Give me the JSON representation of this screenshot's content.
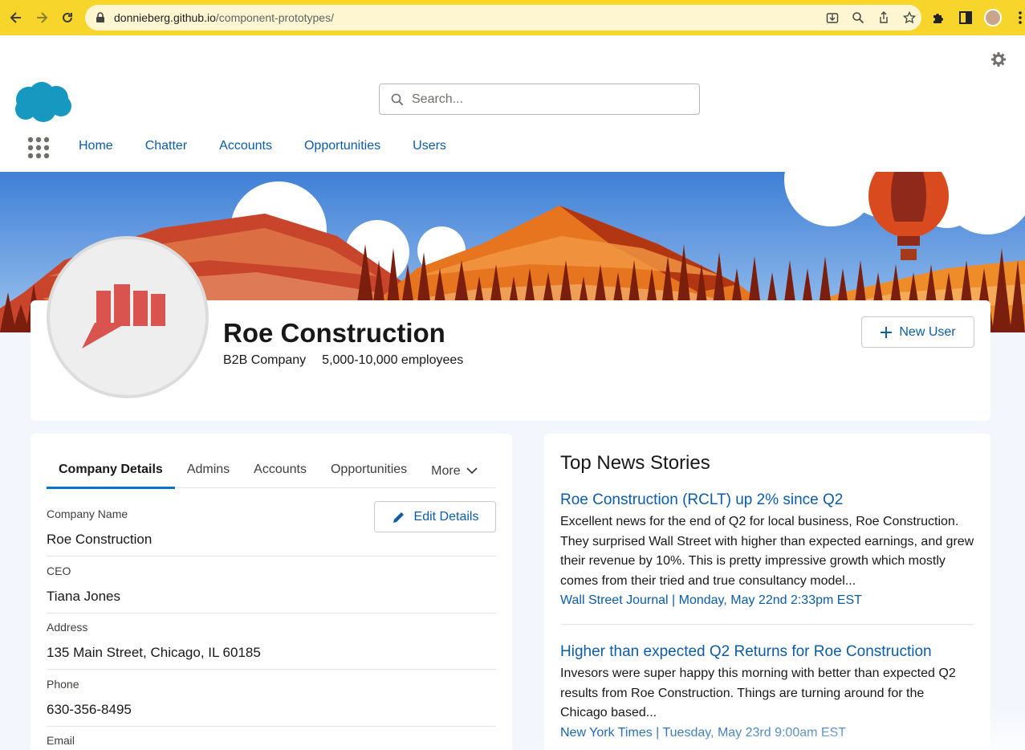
{
  "browser": {
    "url_host": "donnieberg.github.io",
    "url_path": "/component-prototypes/"
  },
  "header": {
    "search_placeholder": "Search...",
    "nav": [
      "Home",
      "Chatter",
      "Accounts",
      "Opportunities",
      "Users"
    ]
  },
  "profile": {
    "name": "Roe Construction",
    "type": "B2B Company",
    "employees": "5,000-10,000 employees",
    "new_user_label": "New User"
  },
  "details": {
    "tabs": [
      "Company Details",
      "Admins",
      "Accounts",
      "Opportunities"
    ],
    "more_label": "More",
    "edit_label": "Edit Details",
    "fields": [
      {
        "label": "Company Name",
        "value": "Roe Construction"
      },
      {
        "label": "CEO",
        "value": "Tiana Jones"
      },
      {
        "label": "Address",
        "value": "135 Main Street, Chicago, IL 60185"
      },
      {
        "label": "Phone",
        "value": "630-356-8495"
      },
      {
        "label": "Email",
        "value": ""
      }
    ]
  },
  "news": {
    "title": "Top News Stories",
    "stories": [
      {
        "headline": "Roe Construction (RCLT) up 2% since Q2",
        "body": "Excellent news for the end of Q2 for local business, Roe Construction. They surprised Wall Street with higher than expected earnings, and grew their revenue by 10%. This is pretty impressive growth which mostly comes from their tried and true consultancy model...",
        "source": "Wall Street Journal | Monday, May 22nd 2:33pm EST"
      },
      {
        "headline": "Higher than expected Q2 Returns for Roe Construction",
        "body": "Invesors were super happy this morning with better than expected Q2 results from Roe Construction. Things are turning around for the Chicago based...",
        "source": "New York Times | Tuesday, May 23rd 9:00am EST"
      }
    ]
  },
  "colors": {
    "chrome": "#f7d52a",
    "link": "#0b5cab",
    "brand_blue": "#1798c1",
    "logo_red": "#d9534f"
  }
}
